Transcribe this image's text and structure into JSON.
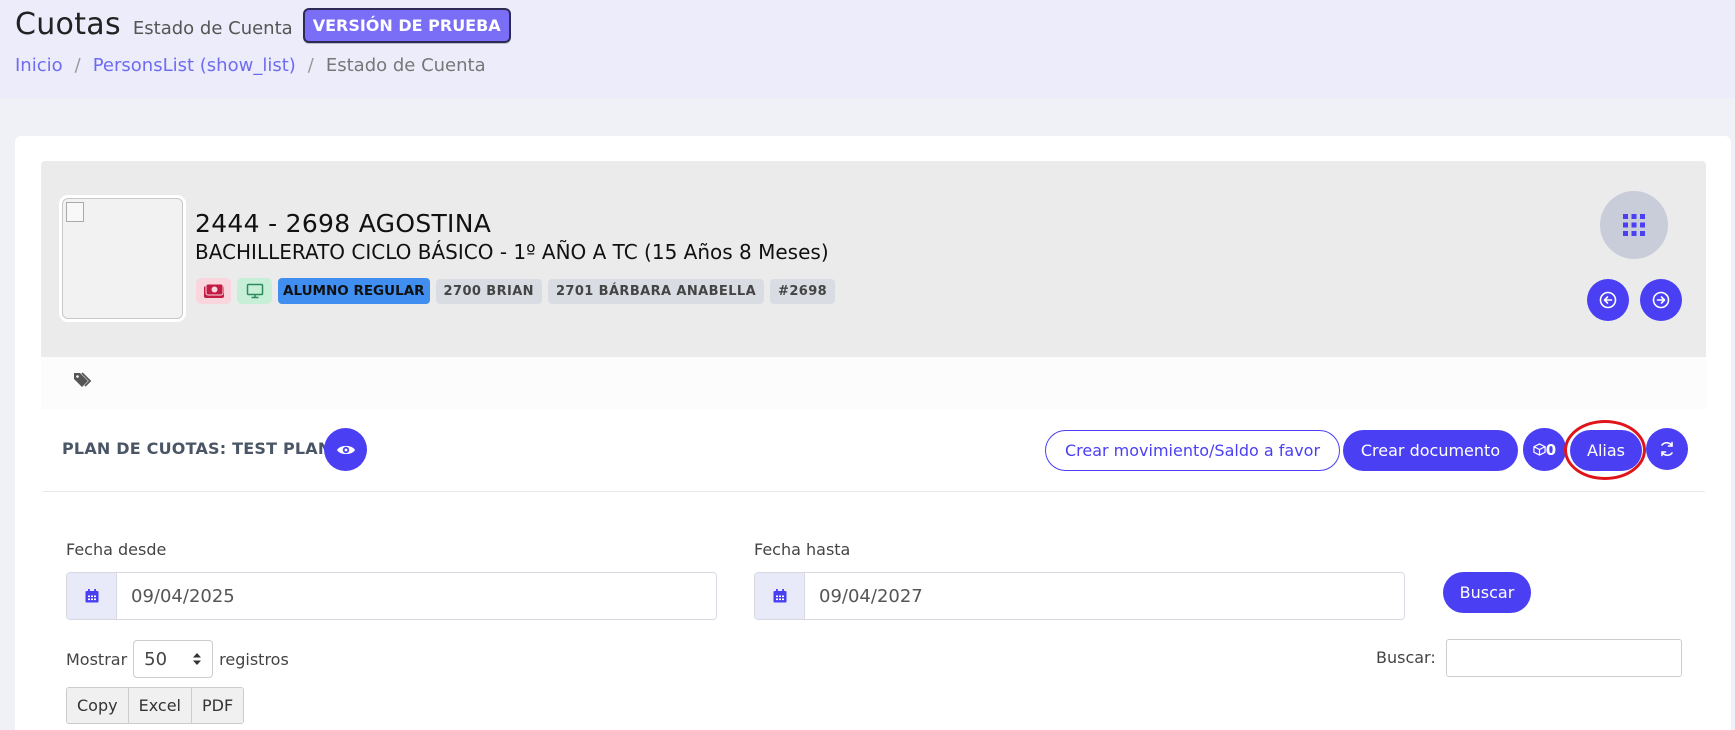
{
  "header": {
    "title": "Cuotas",
    "subtitle": "Estado de Cuenta",
    "badge": "VERSIÓN DE PRUEBA"
  },
  "breadcrumb": {
    "items": [
      "Inicio",
      "PersonsList (show_list)",
      "Estado de Cuenta"
    ],
    "separator": "/"
  },
  "profile": {
    "name": "2444 - 2698 AGOSTINA",
    "course": "BACHILLERATO CICLO BÁSICO - 1º AÑO A TC (15 Años 8 Meses)",
    "status": "ALUMNO REGULAR",
    "pills": [
      "2700 BRIAN",
      "2701 BÁRBARA ANABELLA",
      "#2698"
    ]
  },
  "plan": {
    "title": "PLAN DE CUOTAS: TEST PLAN 1",
    "buttons": {
      "create_movement": "Crear movimiento/Saldo a favor",
      "create_document": "Crear documento",
      "count": "0",
      "alias": "Alias"
    }
  },
  "filters": {
    "from_label": "Fecha desde",
    "from_value": "09/04/2025",
    "to_label": "Fecha hasta",
    "to_value": "09/04/2027",
    "search_button": "Buscar"
  },
  "table_controls": {
    "show_label": "Mostrar",
    "show_value": "50",
    "records_label": "registros",
    "search_label": "Buscar:",
    "exports": [
      "Copy",
      "Excel",
      "PDF"
    ]
  },
  "colors": {
    "primary": "#4a3ff2",
    "trial_badge": "#7b6ef6",
    "status_pill": "#3f8ef0",
    "highlight_ring": "#e0151b"
  }
}
